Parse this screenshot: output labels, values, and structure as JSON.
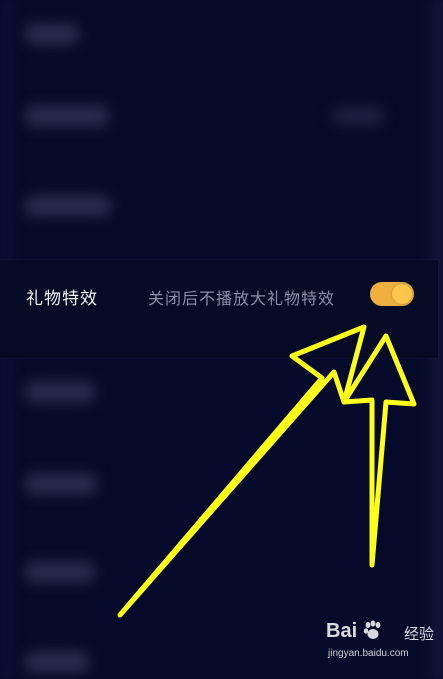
{
  "settings": {
    "gift_effects": {
      "label": "礼物特效",
      "description": "关闭后不播放大礼物特效",
      "toggle_on": true
    }
  },
  "colors": {
    "background": "#060a2a",
    "toggle_accent": "#f0b040",
    "arrow": "#ffff1a"
  },
  "watermark": {
    "brand": "Bai",
    "brand_suffix": "经验",
    "url": "jingyan.baidu.com"
  }
}
